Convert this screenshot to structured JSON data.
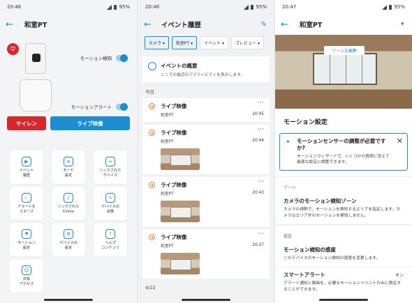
{
  "panel1": {
    "status": {
      "time": "20:46",
      "battery": "95%"
    },
    "title": "和室PT",
    "motion_detect_label": "モーション検知",
    "motion_alert_label": "モーションアラート",
    "siren_label": "サイレン",
    "live_label": "ライブ映像",
    "tiles": [
      {
        "label": "イベント\n履歴",
        "icon": "clock-icon",
        "glyph": "▶"
      },
      {
        "label": "モード\n設定",
        "icon": "shield-icon",
        "glyph": "≡"
      },
      {
        "label": "リンクされた\nデバイス",
        "icon": "link-icon",
        "glyph": "∞"
      },
      {
        "label": "アラートを\nスヌーズ",
        "icon": "snooze-icon",
        "glyph": "☾"
      },
      {
        "label": "リンクされた\nChime",
        "icon": "chime-icon",
        "glyph": "♪"
      },
      {
        "label": "デバイスの\n状態",
        "icon": "pulse-icon",
        "glyph": "∿"
      },
      {
        "label": "モーション\n設定",
        "icon": "runner-icon",
        "glyph": "⚑"
      },
      {
        "label": "デバイスの\n設定",
        "icon": "gear-icon",
        "glyph": "⚙"
      },
      {
        "label": "ヘルプ\nコンテンツ",
        "icon": "help-icon",
        "glyph": "?"
      },
      {
        "label": "共有\nアクセス",
        "icon": "users-icon",
        "glyph": "☺"
      }
    ]
  },
  "panel2": {
    "status": {
      "time": "20:46",
      "battery": "95%"
    },
    "title": "イベント履歴",
    "filters": [
      "カメラ ▾",
      "和室PT ▾",
      "イベント ▾",
      "プレビュー ▾"
    ],
    "overview_title": "イベントの概要",
    "overview_sub": "ここでの最近のアクティビティを表示します。",
    "day_label": "今日",
    "events": [
      {
        "title": "ライブ映像",
        "device": "和室PT",
        "time": "20:45",
        "thumb": false
      },
      {
        "title": "ライブ映像",
        "device": "和室PT",
        "time": "20:44",
        "thumb": true
      },
      {
        "title": "ライブ映像",
        "device": "和室PT",
        "time": "20:43",
        "thumb": true
      },
      {
        "title": "ライブ映像",
        "device": "和室PT",
        "time": "20:27",
        "thumb": true
      }
    ],
    "next_day": "9/22"
  },
  "panel3": {
    "status": {
      "time": "20:47",
      "battery": "95%"
    },
    "title": "和室PT",
    "zone_edit": "ゾーンを編集",
    "section": "モーション設定",
    "alert_title": "モーションセンサーの調整が必要ですか?",
    "alert_body": "モーションウィザードで、いくつかの質問に答えて最適な設定に調整できます。",
    "group_zone": "ゾーン",
    "zone_title": "カメラのモーション検知ゾーン",
    "zone_body": "カメラの視野で、モーションを検知するエリアを指定します。カメラはエリア外のモーションを検知しません。",
    "group_settings": "設定",
    "sens_title": "モーション検知の感度",
    "sens_body": "このデバイスのモーション検知の感度を変更します。",
    "smart_title": "スマートアラート",
    "smart_value": "オン",
    "smart_body": "アラート通知と録画を、必要なモーションイベントのみに限定することができます。"
  }
}
